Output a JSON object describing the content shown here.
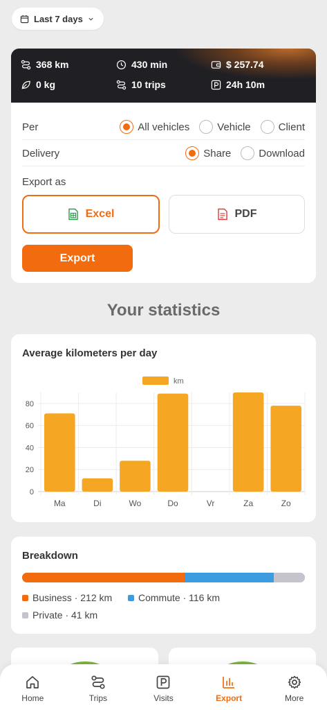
{
  "date_filter": {
    "label": "Last 7 days"
  },
  "summary": {
    "distance": "368 km",
    "duration": "430 min",
    "cost": "$ 257.74",
    "co2": "0 kg",
    "trips": "10 trips",
    "parking": "24h 10m"
  },
  "export": {
    "per_label": "Per",
    "per_options": [
      "All vehicles",
      "Vehicle",
      "Client"
    ],
    "per_selected": "All vehicles",
    "delivery_label": "Delivery",
    "delivery_options": [
      "Share",
      "Download"
    ],
    "delivery_selected": "Share",
    "export_as_label": "Export as",
    "excel_label": "Excel",
    "pdf_label": "PDF",
    "export_button": "Export"
  },
  "stats_title": "Your statistics",
  "chart_card_title": "Average kilometers per day",
  "chart_data": {
    "type": "bar",
    "title": "Average kilometers per day",
    "categories": [
      "Ma",
      "Di",
      "Wo",
      "Do",
      "Vr",
      "Za",
      "Zo"
    ],
    "series": [
      {
        "name": "km",
        "values": [
          71,
          12,
          28,
          89,
          0,
          90,
          78
        ]
      }
    ],
    "yticks": [
      0,
      20,
      40,
      60,
      80
    ],
    "ylim": [
      0,
      90
    ],
    "grid": true,
    "legend": "top-center",
    "color": "#f5a623"
  },
  "breakdown": {
    "title": "Breakdown",
    "items": [
      {
        "name": "Business",
        "value": 212,
        "label": "Business · 212 km",
        "color": "#f26b0f"
      },
      {
        "name": "Commute",
        "value": 116,
        "label": "Commute · 116 km",
        "color": "#3d9be0"
      },
      {
        "name": "Private",
        "value": 41,
        "label": "Private · 41 km",
        "color": "#c4c4cc"
      }
    ]
  },
  "nav": {
    "items": [
      {
        "label": "Home",
        "icon": "home-icon"
      },
      {
        "label": "Trips",
        "icon": "route-icon"
      },
      {
        "label": "Visits",
        "icon": "parking-icon"
      },
      {
        "label": "Export",
        "icon": "bar-chart-icon"
      },
      {
        "label": "More",
        "icon": "gear-icon"
      }
    ],
    "active": "Export"
  },
  "colors": {
    "accent": "#f26b0f",
    "bar": "#f5a623",
    "commute": "#3d9be0",
    "private": "#c4c4cc"
  }
}
